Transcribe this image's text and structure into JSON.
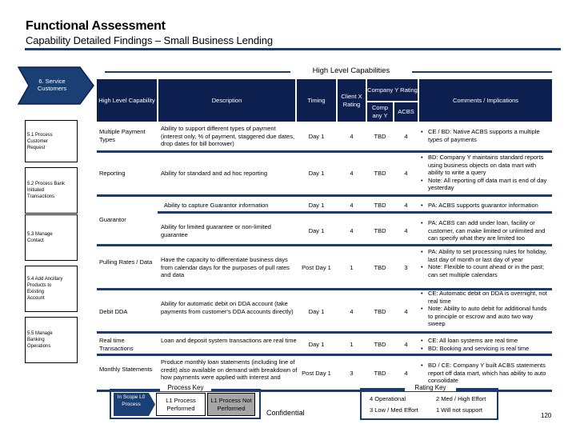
{
  "header": {
    "title": "Functional Assessment",
    "subtitle": "Capability Detailed Findings – Small Business Lending"
  },
  "section": {
    "banner": "High Level Capabilities",
    "chevron": "6. Service Customers"
  },
  "table": {
    "columns": {
      "capability": "High Level Capability",
      "description": "Description",
      "timing": "Timing",
      "client_rating": "Client X Rating",
      "company_rating_group": "Company Y Rating",
      "company": "Comp any Y",
      "acbs": "ACBS",
      "comments": "Comments / Implications"
    },
    "rows": [
      {
        "capability": "Multiple Payment Types",
        "description": "Ability to support different types of payment (interest only, % of payment, staggered due dates, drop dates for bill borrower)",
        "timing": "Day 1",
        "client": "4",
        "company": "TBD",
        "acbs": "4",
        "comments": [
          "CE / BD: Native ACBS supports a multiple types of payments"
        ]
      },
      {
        "capability": "Reporting",
        "description": "Ability for standard and ad hoc reporting",
        "timing": "Day 1",
        "client": "4",
        "company": "TBD",
        "acbs": "4",
        "comments": [
          "BD: Company Y maintains standard reports using business objects on data mart with ability to write a query",
          "Note: All reporting off data mart is end of day yesterday"
        ]
      },
      {
        "capability": "Guarantor",
        "description": "Ability to capture Guarantor information",
        "timing": "Day 1",
        "client": "4",
        "company": "TBD",
        "acbs": "4",
        "comments": [
          "PA: ACBS supports guarantor information"
        ]
      },
      {
        "capability": "",
        "description": "Ability for limited guarantee or non-limited guarantee",
        "timing": "Day 1",
        "client": "4",
        "company": "TBD",
        "acbs": "4",
        "comments": [
          "PA: ACBS can add under loan, facility or customer, can make limited or unlimited and can specify what they are limited too"
        ]
      },
      {
        "capability": "Pulling Rates / Data",
        "description": "Have the capacity to differentiate business days from calendar days for the purposes of pull rates and data",
        "timing": "Post Day 1",
        "client": "1",
        "company": "TBD",
        "acbs": "3",
        "comments": [
          "PA: Ability to set processing rules for holiday, last day of month or last day of year",
          "Note: Flexible to count ahead or in the past; can set multiple calendars"
        ]
      },
      {
        "capability": "Debit DDA",
        "description": "Ability for automatic debit on DDA account (take payments from customer's DDA accounts directly)",
        "timing": "Day 1",
        "client": "4",
        "company": "TBD",
        "acbs": "4",
        "comments": [
          "CE: Automatic debit on DDA is overnight, not real time",
          "Note: Ability to auto debit for additional funds to principle or escrow and auto two way sweep"
        ]
      },
      {
        "capability": "Real time Transactions",
        "description": "Loan and deposit system transactions are real time",
        "timing": "Day 1",
        "client": "1",
        "company": "TBD",
        "acbs": "4",
        "comments": [
          "CE: All loan systems are real time",
          "BD: Booking and servicing is real time"
        ]
      },
      {
        "capability": "Monthly Statements",
        "description": "Produce monthly loan statements (including line of credit) also available on demand with breakdown of how payments were applied with interest and escrows",
        "timing": "Post Day 1",
        "client": "3",
        "company": "TBD",
        "acbs": "4",
        "comments": [
          "BD / CE: Company Y built ACBS statements report off data mart, which has ability to auto consolidate"
        ]
      }
    ]
  },
  "processes": [
    {
      "label": "5.1 Process\n    Customer\n    Request"
    },
    {
      "label": "5.2 Process Bank\n    Initiated\n    Transactions"
    },
    {
      "label": "5.3 Manage\n    Contact"
    },
    {
      "label": "5.4 Add Ancillary\n    Products to\n    Existing\n    Account"
    },
    {
      "label": "5.5 Manage\n    Banking\n    Operations"
    }
  ],
  "process_key": {
    "title": "Process Key",
    "in_scope": "In Scope L0 Process",
    "performed": "L1 Process Performed",
    "not_performed": "L1 Process Not Performed"
  },
  "rating_key": {
    "title": "Rating Key",
    "items": [
      "4  Operational",
      "2  Med / High Effort",
      "3  Low / Med Effort",
      "1  Will not support"
    ]
  },
  "footer": {
    "confidential": "Confidential",
    "page": "120"
  },
  "colors": {
    "navy": "#0d1f4f",
    "rule": "#1c3b73",
    "chevron": "#1a3f74",
    "not_performed_gray": "#a6a6a6"
  }
}
